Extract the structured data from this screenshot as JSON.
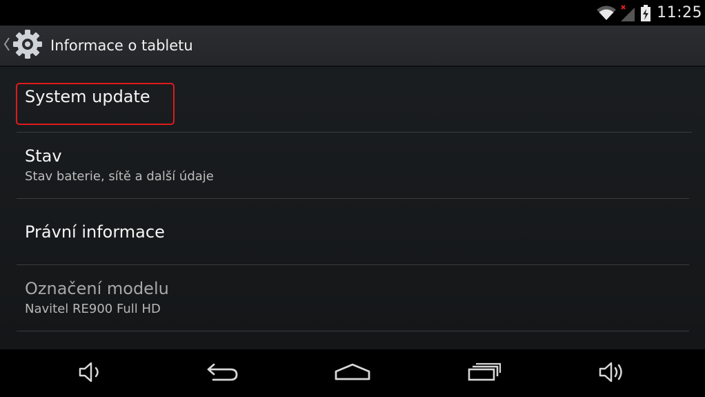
{
  "status_bar": {
    "time": "11:25",
    "icons": [
      "wifi-icon",
      "signal-no-sim-icon",
      "battery-charging-icon"
    ]
  },
  "action_bar": {
    "title": "Informace o tabletu",
    "icon": "settings-gear-icon"
  },
  "list": {
    "items": [
      {
        "title": "System update",
        "summary": ""
      },
      {
        "title": "Stav",
        "summary": "Stav baterie, sítě a další údaje"
      },
      {
        "title": "Právní informace",
        "summary": ""
      },
      {
        "title": "Označení modelu",
        "summary": "Navitel RE900 Full HD"
      }
    ]
  },
  "highlight": {
    "color": "#e01a1a"
  },
  "navigation_bar": {
    "buttons": [
      "volume-down-icon",
      "back-icon",
      "home-icon",
      "recent-apps-icon",
      "volume-up-icon"
    ]
  },
  "colors": {
    "background": "#16181a",
    "action_bar": "#2a2c2f",
    "divider": "#3a3d40",
    "text_primary": "#f5f5f5",
    "text_secondary": "#bdbdbd"
  }
}
